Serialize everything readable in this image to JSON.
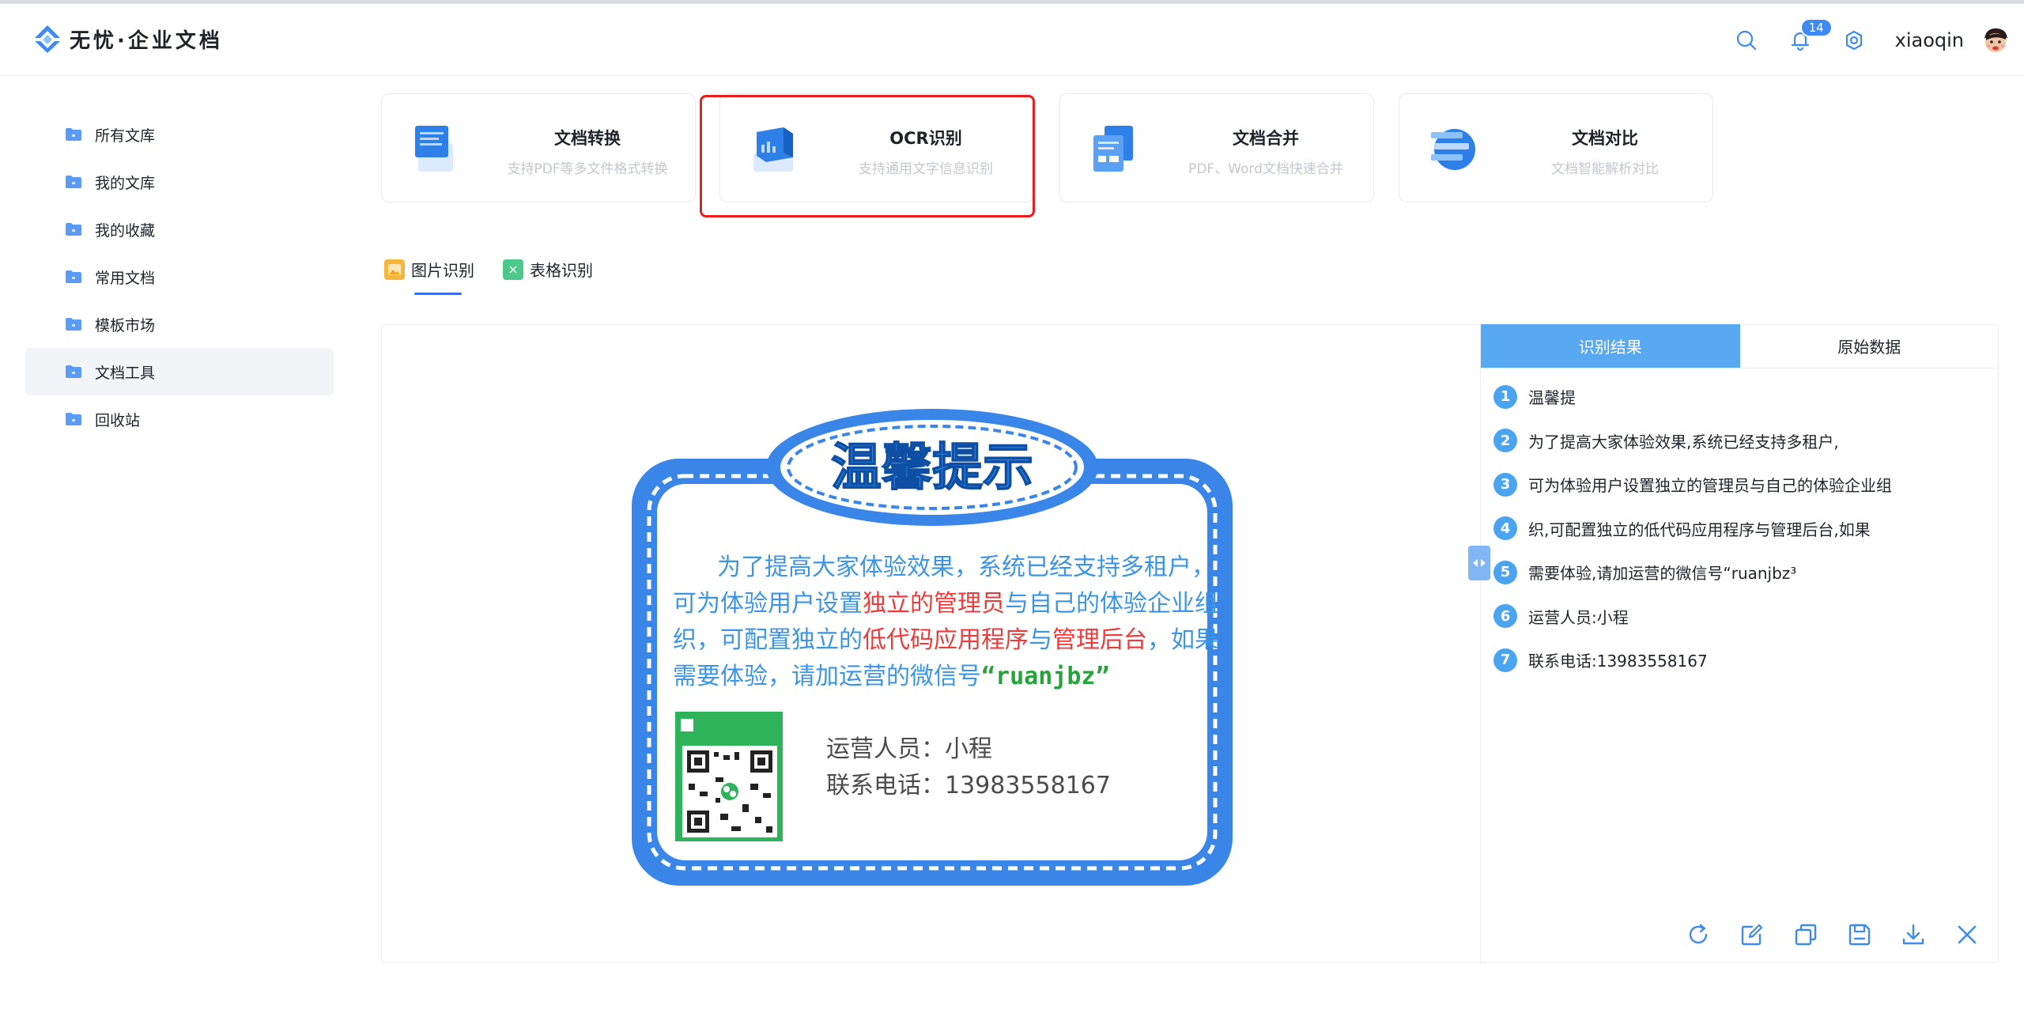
{
  "header": {
    "app_name": "无忧·企业文档",
    "notification_count": "14",
    "username": "xiaoqin",
    "accent": "#3d8bf2"
  },
  "sidebar": {
    "items": [
      {
        "label": "所有文库",
        "icon": "folder-icon"
      },
      {
        "label": "我的文库",
        "icon": "folder-icon"
      },
      {
        "label": "我的收藏",
        "icon": "folder-icon"
      },
      {
        "label": "常用文档",
        "icon": "folder-icon"
      },
      {
        "label": "模板市场",
        "icon": "folder-icon"
      },
      {
        "label": "文档工具",
        "icon": "folder-icon",
        "active": true
      },
      {
        "label": "回收站",
        "icon": "folder-icon"
      }
    ]
  },
  "tools": [
    {
      "title": "文档转换",
      "subtitle": "支持PDF等多文件格式转换",
      "icon": "document-convert-icon"
    },
    {
      "title": "OCR识别",
      "subtitle": "支持通用文字信息识别",
      "icon": "ocr-icon",
      "selected": true
    },
    {
      "title": "文档合并",
      "subtitle": "PDF、Word文档快速合并",
      "icon": "document-merge-icon"
    },
    {
      "title": "文档对比",
      "subtitle": "文档智能解析对比",
      "icon": "document-compare-icon"
    }
  ],
  "subtabs": [
    {
      "label": "图片识别",
      "icon": "image-icon",
      "active": true
    },
    {
      "label": "表格识别",
      "icon": "table-icon"
    }
  ],
  "preview": {
    "banner_title": "温馨提示",
    "line1": "为了提高大家体验效果，系统已经支持多租户，",
    "line2_a": "可为体验用户设置",
    "line2_b": "独立的管理员",
    "line2_c": "与自己的体验企业组",
    "line3_a": "织，可配置独立的",
    "line3_b": "低代码应用程序",
    "line3_c": "与",
    "line3_d": "管理后台",
    "line3_e": "，如果",
    "line4_a": "需要体验，请加运营的微信号",
    "line4_b": "“ruanjbz”",
    "operator": "运营人员：小程",
    "phone": "联系电话：13983558167"
  },
  "result": {
    "tabs": [
      "识别结果",
      "原始数据"
    ],
    "lines": [
      {
        "n": "1",
        "text": "温馨提"
      },
      {
        "n": "2",
        "text": "为了提高大家体验效果,系统已经支持多租户,"
      },
      {
        "n": "3",
        "text": "可为体验用户设置独立的管理员与自己的体验企业组"
      },
      {
        "n": "4",
        "text": "织,可配置独立的低代码应用程序与管理后台,如果"
      },
      {
        "n": "5",
        "text": "需要体验,请加运营的微信号“ruanjbz³"
      },
      {
        "n": "6",
        "text": "运营人员:小程"
      },
      {
        "n": "7",
        "text": "联系电话:13983558167"
      }
    ],
    "actions": [
      "refresh-icon",
      "edit-icon",
      "copy-icon",
      "save-icon",
      "download-icon",
      "close-icon"
    ]
  }
}
